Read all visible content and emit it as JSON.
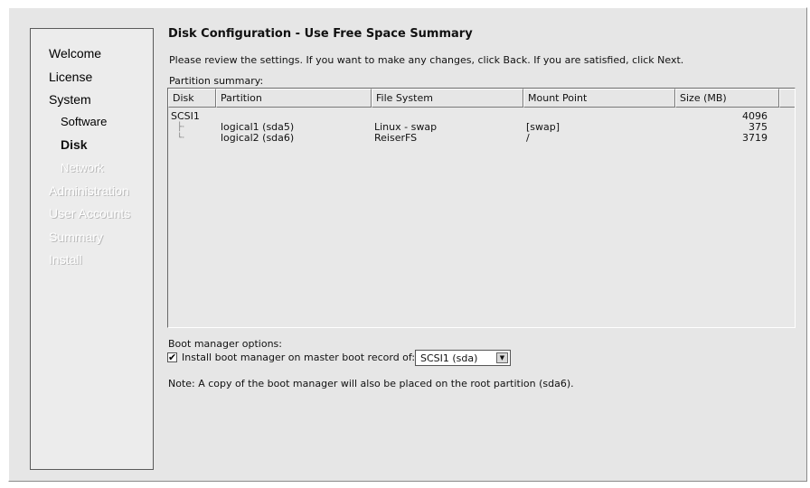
{
  "sidebar": {
    "items": [
      {
        "label": "Welcome",
        "state": "active"
      },
      {
        "label": "License",
        "state": "active"
      },
      {
        "label": "System",
        "state": "active"
      },
      {
        "label": "Software",
        "state": "active"
      },
      {
        "label": "Disk",
        "state": "current"
      },
      {
        "label": "Network",
        "state": "dim"
      },
      {
        "label": "Administration",
        "state": "dim"
      },
      {
        "label": "User Accounts",
        "state": "dim"
      },
      {
        "label": "Summary",
        "state": "dim"
      },
      {
        "label": "Install",
        "state": "dim"
      }
    ]
  },
  "main": {
    "title": "Disk Configuration - Use Free Space Summary",
    "instructions": "Please review the settings. If you want to make any changes, click Back. If you are satisfied, click Next.",
    "summary_label": "Partition summary:",
    "table": {
      "columns": [
        "Disk",
        "Partition",
        "File System",
        "Mount Point",
        "Size (MB)"
      ],
      "rows": [
        {
          "disk": "SCSI1",
          "partition": "",
          "filesystem": "",
          "mount": "",
          "size": "4096"
        },
        {
          "disk": "",
          "partition": "logical1 (sda5)",
          "filesystem": "Linux - swap",
          "mount": "[swap]",
          "size": "375"
        },
        {
          "disk": "",
          "partition": "logical2 (sda6)",
          "filesystem": "ReiserFS",
          "mount": "/",
          "size": "3719"
        }
      ]
    },
    "boot": {
      "label": "Boot manager options:",
      "checkbox_label": "Install boot manager on master boot record of:",
      "checked": true,
      "selected": "SCSI1 (sda)"
    },
    "note": "Note: A copy of the boot manager will also be placed on the root partition (sda6)."
  }
}
